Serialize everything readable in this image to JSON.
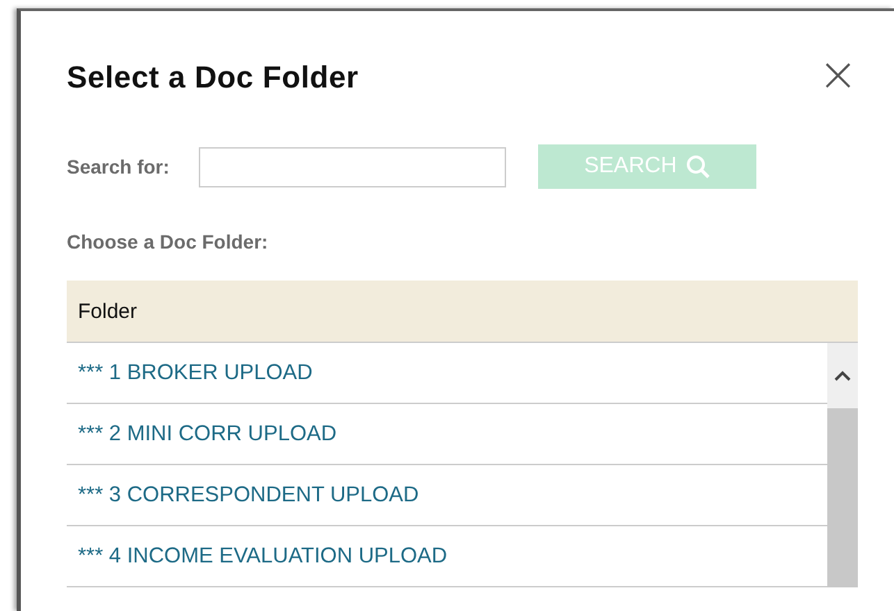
{
  "dialog": {
    "title": "Select a Doc Folder",
    "close": "×"
  },
  "search": {
    "label": "Search for:",
    "button": "SEARCH",
    "disabled": true
  },
  "choose_label": "Choose a Doc Folder:",
  "table": {
    "columns": [
      "Folder"
    ],
    "rows": [
      {
        "name": "*** 1 BROKER UPLOAD"
      },
      {
        "name": "*** 2 MINI CORR UPLOAD"
      },
      {
        "name": "*** 3 CORRESPONDENT UPLOAD"
      },
      {
        "name": "*** 4 INCOME EVALUATION UPLOAD"
      }
    ]
  }
}
